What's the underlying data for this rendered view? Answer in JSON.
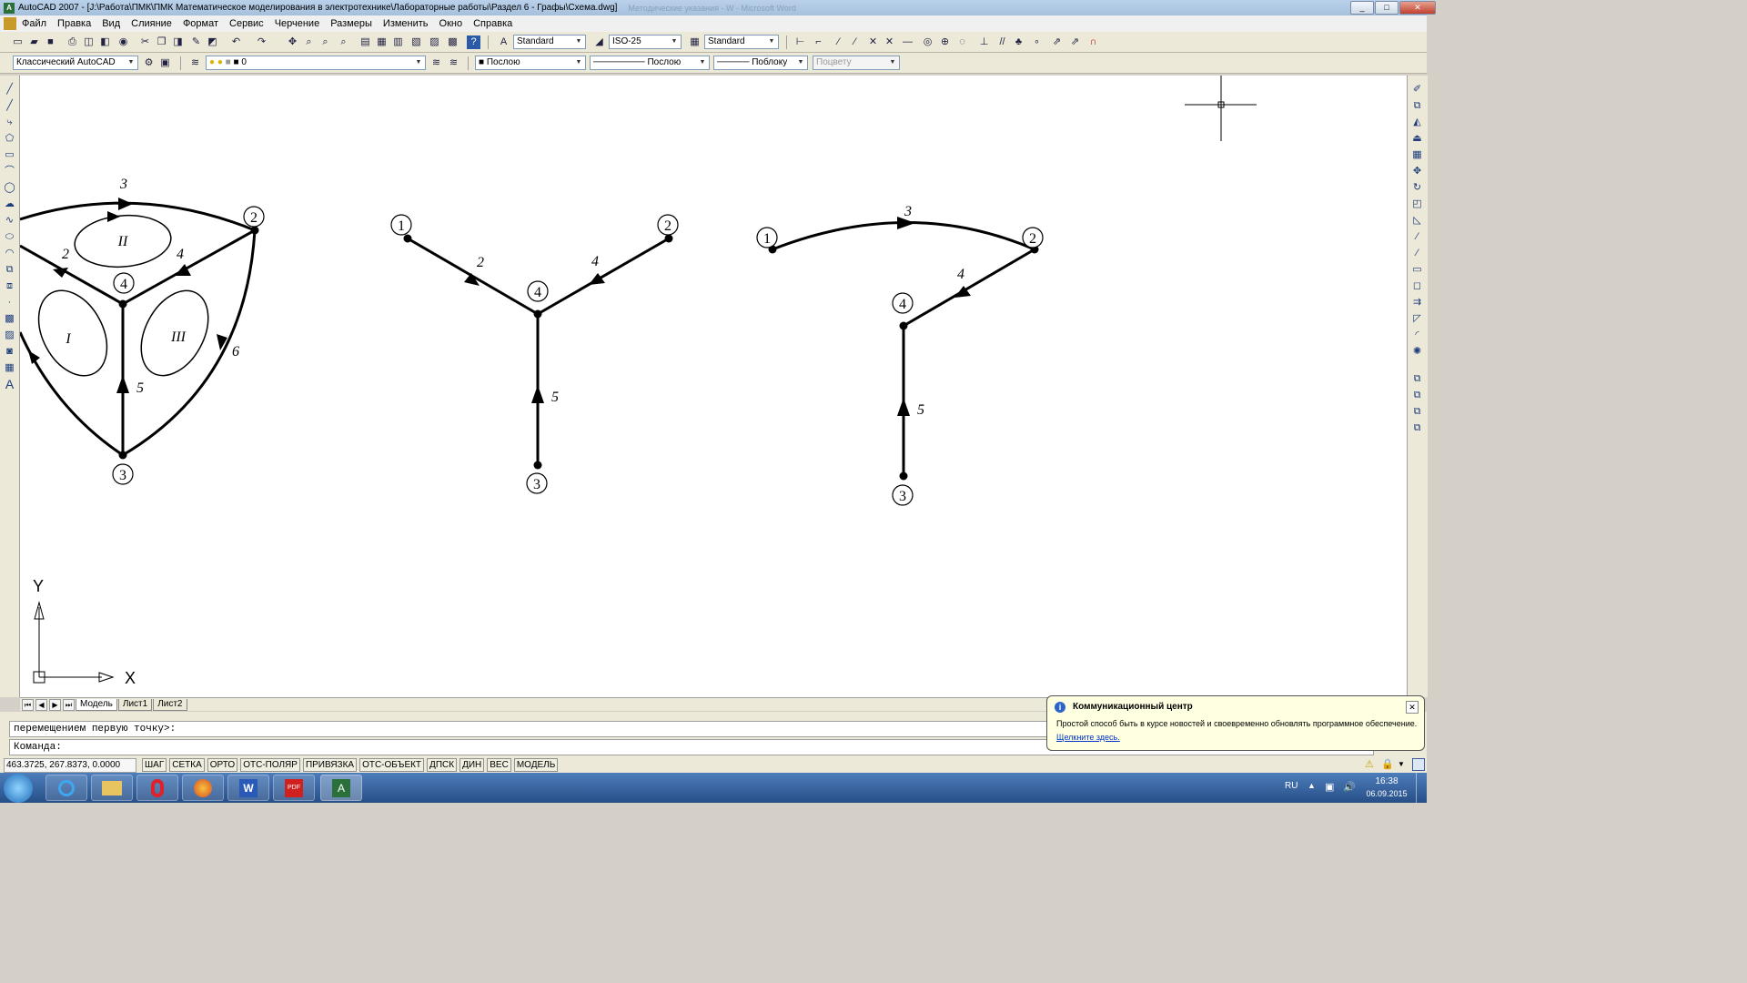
{
  "window": {
    "title": "AutoCAD 2007 - [J:\\Работа\\ПМК\\ПМК Математическое моделирования в электротехнике\\Лабораторные работы\\Раздел 6 - Графы\\Схема.dwg]",
    "ghost_title": "Методические указания - W - Microsoft Word",
    "min": "_",
    "max": "□",
    "close": "✕"
  },
  "menu": [
    "Файл",
    "Правка",
    "Вид",
    "Слияние",
    "Формат",
    "Сервис",
    "Черчение",
    "Размеры",
    "Изменить",
    "Окно",
    "Справка"
  ],
  "toolbar1": {
    "text_style": "Standard",
    "dim_style": "ISO-25",
    "table_style": "Standard"
  },
  "toolbar2": {
    "workspace": "Классический AutoCAD",
    "layer": "0",
    "color": "Послою",
    "linetype": "Послою",
    "lineweight": "Поблоку",
    "plotstyle": "Поцвету"
  },
  "drawing": {
    "graph1": {
      "nodes": [
        "2",
        "4",
        "3"
      ],
      "edges": [
        "3",
        "2",
        "4",
        "5",
        "6"
      ],
      "loops": [
        "I",
        "II",
        "III"
      ]
    },
    "graph2": {
      "nodes": [
        "1",
        "2",
        "4",
        "3"
      ],
      "edges": [
        "2",
        "4",
        "5"
      ]
    },
    "graph3": {
      "nodes": [
        "1",
        "2",
        "4",
        "3"
      ],
      "edges": [
        "3",
        "4",
        "5"
      ]
    },
    "ucs": {
      "x": "X",
      "y": "Y"
    }
  },
  "tabs": [
    "Модель",
    "Лист1",
    "Лист2"
  ],
  "command": {
    "line1": "перемещением первую точку>:",
    "line2": "Команда:"
  },
  "status": {
    "coords": "463.3725, 267.8373, 0.0000",
    "buttons": [
      "ШАГ",
      "СЕТКА",
      "ОРТО",
      "ОТС-ПОЛЯР",
      "ПРИВЯЗКА",
      "ОТС-ОБЪЕКТ",
      "ДПСК",
      "ДИН",
      "ВЕС",
      "МОДЕЛЬ"
    ]
  },
  "balloon": {
    "title": "Коммуникационный центр",
    "text": "Простой способ быть в курсе новостей и своевременно обновлять программное обеспечение.",
    "link": "Щелкните здесь."
  },
  "tray": {
    "lang": "RU",
    "time": "16:38",
    "date": "06.09.2015"
  }
}
